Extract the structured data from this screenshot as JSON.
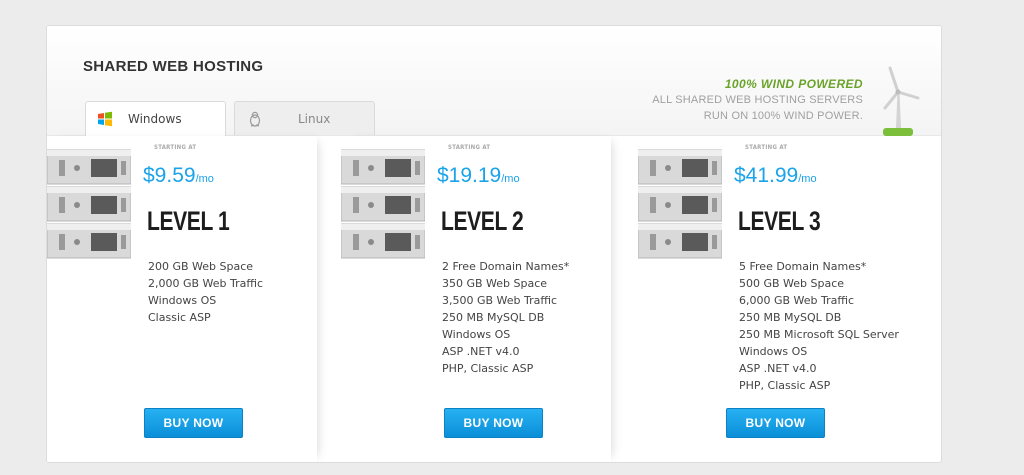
{
  "header": {
    "title": "SHARED WEB HOSTING"
  },
  "tabs": [
    {
      "label": "Windows",
      "icon": "windows-logo-icon",
      "active": true
    },
    {
      "label": "Linux",
      "icon": "linux-penguin-icon",
      "active": false
    }
  ],
  "wind_notice": {
    "headline": "100% WIND POWERED",
    "line1": "ALL SHARED WEB HOSTING SERVERS",
    "line2": "RUN ON 100% WIND POWER.",
    "accent_color": "#6aa32a",
    "icon": "wind-turbine-icon"
  },
  "plans": [
    {
      "starting_label": "STARTING AT",
      "price": "$9.59",
      "period": "/mo",
      "name": "LEVEL 1",
      "features": [
        "200 GB Web Space",
        "2,000 GB Web Traffic",
        "Windows OS",
        "Classic ASP"
      ],
      "buy_label": "BUY NOW",
      "icon": "server-rack-icon"
    },
    {
      "starting_label": "STARTING AT",
      "price": "$19.19",
      "period": "/mo",
      "name": "LEVEL 2",
      "features": [
        "2 Free Domain Names*",
        "350 GB Web Space",
        "3,500 GB Web Traffic",
        "250 MB MySQL DB",
        "Windows OS",
        "ASP .NET v4.0",
        "PHP, Classic ASP"
      ],
      "buy_label": "BUY NOW",
      "icon": "server-rack-icon"
    },
    {
      "starting_label": "STARTING AT",
      "price": "$41.99",
      "period": "/mo",
      "name": "LEVEL 3",
      "features": [
        "5 Free Domain Names*",
        "500 GB Web Space",
        "6,000 GB Web Traffic",
        "250 MB MySQL DB",
        "250 MB Microsoft SQL Server",
        "Windows OS",
        "ASP .NET v4.0",
        "PHP, Classic ASP"
      ],
      "buy_label": "BUY NOW",
      "icon": "server-rack-icon"
    }
  ],
  "colors": {
    "price": "#1aa3e8",
    "button": "#0a8fd8",
    "background": "#ececec"
  }
}
